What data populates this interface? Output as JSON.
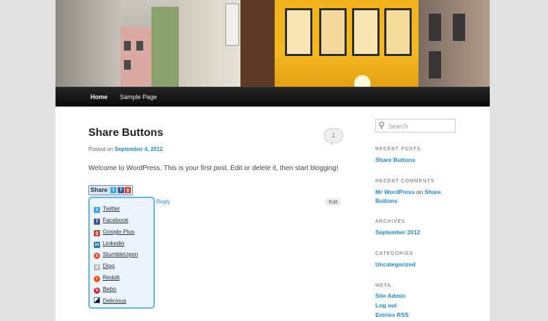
{
  "nav": {
    "items": [
      "Home",
      "Sample Page"
    ]
  },
  "post": {
    "title": "Share Buttons",
    "posted_on": "Posted on",
    "date": "September 4, 2012",
    "comments": "1",
    "body": "Welcome to WordPress. This is your first post. Edit or delete it, then start blogging!",
    "reply": "Reply",
    "edit": "Edit"
  },
  "share": {
    "label": "Share",
    "items": [
      {
        "label": "Twitter",
        "icon": "twitter-icon",
        "color": "#3da9e8"
      },
      {
        "label": "Facebook",
        "icon": "facebook-icon",
        "color": "#3b5998"
      },
      {
        "label": "Google Plus",
        "icon": "google-plus-icon",
        "color": "#d23b2b"
      },
      {
        "label": "Linkedin",
        "icon": "linkedin-icon",
        "color": "#1b77b3"
      },
      {
        "label": "StumbleUpon",
        "icon": "stumbleupon-icon",
        "color": "#eb4924"
      },
      {
        "label": "Digg",
        "icon": "digg-icon",
        "color": "#bbbbbb"
      },
      {
        "label": "Reddit",
        "icon": "reddit-icon",
        "color": "#ff4500"
      },
      {
        "label": "Bebo",
        "icon": "bebo-icon",
        "color": "#e0102c"
      },
      {
        "label": "Delicious",
        "icon": "delicious-icon",
        "color": "#3274d1"
      }
    ]
  },
  "sidebar": {
    "search_placeholder": "Search",
    "recent_posts": {
      "title": "Recent Posts",
      "items": [
        "Share Buttons"
      ]
    },
    "recent_comments": {
      "title": "Recent Comments",
      "author": "Mr WordPress",
      "on": "on",
      "post": "Share Buttons"
    },
    "archives": {
      "title": "Archives",
      "items": [
        "September 2012"
      ]
    },
    "categories": {
      "title": "Categories",
      "items": [
        "Uncategorized"
      ]
    },
    "meta": {
      "title": "Meta",
      "items": [
        "Site Admin",
        "Log out",
        "Entries RSS"
      ]
    }
  }
}
